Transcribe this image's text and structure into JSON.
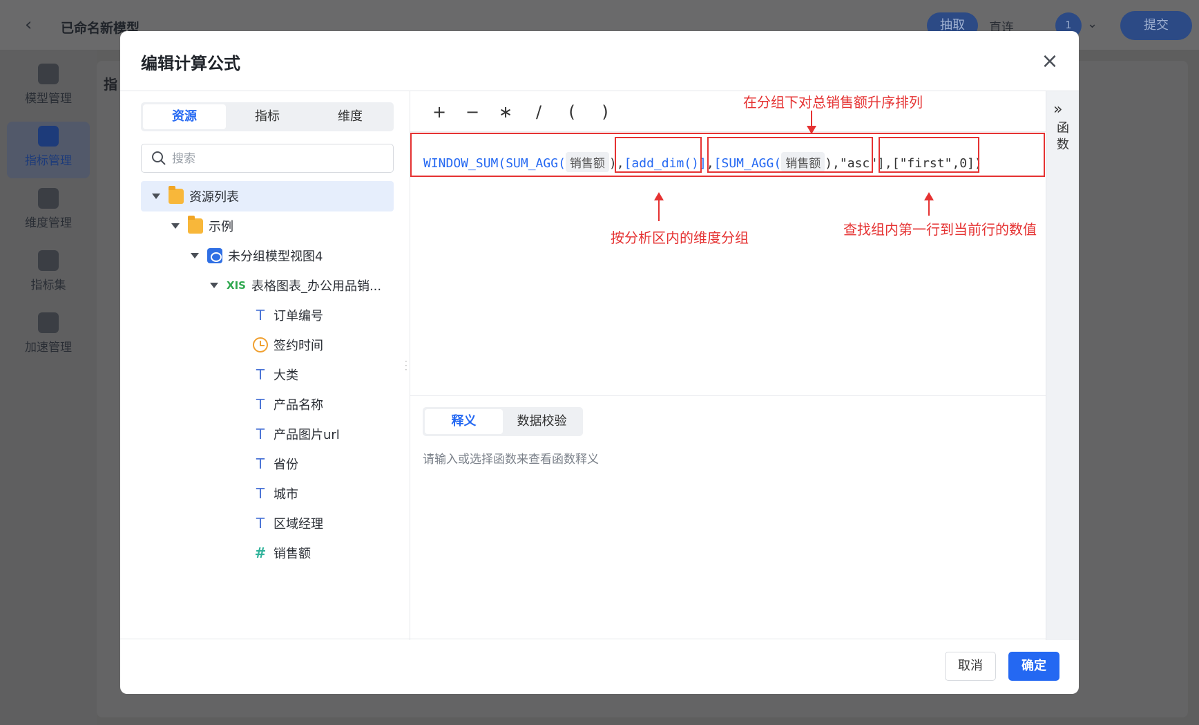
{
  "app": {
    "title": "已命名新模型",
    "extract_label": "抽取",
    "direct_label": "直连",
    "avatar_text": "1",
    "submit_label": "提交",
    "page_heading": "指",
    "sidebar": [
      {
        "label": "模型管理",
        "icon": "model-icon",
        "active": false
      },
      {
        "label": "指标管理",
        "icon": "chart-icon",
        "active": true
      },
      {
        "label": "维度管理",
        "icon": "dimension-icon",
        "active": false
      },
      {
        "label": "指标集",
        "icon": "cube-icon",
        "active": false
      },
      {
        "label": "加速管理",
        "icon": "rocket-icon",
        "active": false
      }
    ]
  },
  "modal": {
    "title": "编辑计算公式",
    "tabs": [
      "资源",
      "指标",
      "维度"
    ],
    "active_tab": "资源",
    "search_placeholder": "搜索",
    "tree": [
      {
        "label": "资源列表",
        "icon": "folder-icon"
      },
      {
        "label": "示例",
        "icon": "folder-icon"
      },
      {
        "label": "未分组模型视图4",
        "icon": "view-icon"
      },
      {
        "label": "表格图表_办公用品销...",
        "icon": "xls-icon"
      },
      {
        "label": "订单编号",
        "icon": "text-field-icon"
      },
      {
        "label": "签约时间",
        "icon": "date-field-icon"
      },
      {
        "label": "大类",
        "icon": "text-field-icon"
      },
      {
        "label": "产品名称",
        "icon": "text-field-icon"
      },
      {
        "label": "产品图片url",
        "icon": "text-field-icon"
      },
      {
        "label": "省份",
        "icon": "text-field-icon"
      },
      {
        "label": "城市",
        "icon": "text-field-icon"
      },
      {
        "label": "区域经理",
        "icon": "text-field-icon"
      },
      {
        "label": "销售额",
        "icon": "number-field-icon"
      }
    ],
    "operators": [
      "+",
      "−",
      "∗",
      "/",
      "(",
      ")"
    ],
    "formula": {
      "fn1": "WINDOW_SUM(SUM_AGG(",
      "field1": "销售额",
      "part2": "),",
      "part3": "[add_dim()]",
      "part4": ",",
      "part5": "[SUM_AGG(",
      "field2": "销售额",
      "part6": "),\"asc\"]",
      "part7": ",",
      "part8": "[\"first\",0])"
    },
    "annotations": {
      "top": "在分组下对总销售额升序排列",
      "left": "按分析区内的维度分组",
      "right": "查找组内第一行到当前行的数值"
    },
    "bottom_tabs": [
      "释义",
      "数据校验"
    ],
    "hint": "请输入或选择函数来查看函数释义",
    "func_chevron": "»",
    "func_label": [
      "函",
      "数"
    ],
    "cancel_label": "取消",
    "ok_label": "确定"
  },
  "colors": {
    "accent": "#2468f2",
    "annotation_red": "#e53232",
    "overlay": "#5e5e5e"
  }
}
